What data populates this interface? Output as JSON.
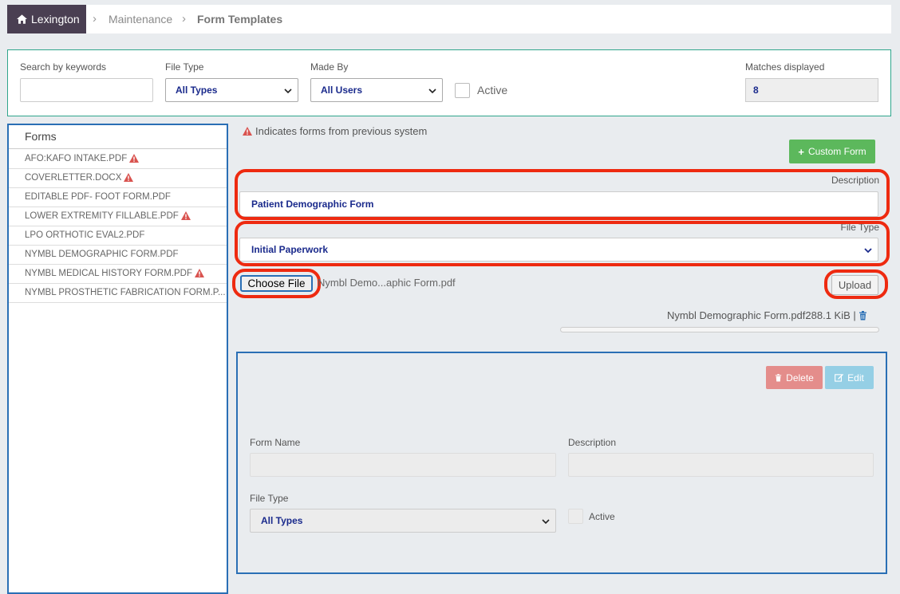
{
  "breadcrumb": {
    "home": "Lexington",
    "items": [
      "Maintenance",
      "Form Templates"
    ]
  },
  "filters": {
    "search_label": "Search by keywords",
    "search_value": "",
    "file_type_label": "File Type",
    "file_type_value": "All Types",
    "made_by_label": "Made By",
    "made_by_value": "All Users",
    "active_label": "Active",
    "matches_label": "Matches displayed",
    "matches_value": "8"
  },
  "forms": {
    "header": "Forms",
    "items": [
      {
        "name": "AFO:KAFO INTAKE.PDF",
        "warning": true
      },
      {
        "name": "COVERLETTER.DOCX",
        "warning": true
      },
      {
        "name": "EDITABLE PDF- FOOT FORM.PDF",
        "warning": false
      },
      {
        "name": "LOWER EXTREMITY FILLABLE.PDF",
        "warning": true
      },
      {
        "name": "LPO ORTHOTIC EVAL2.PDF",
        "warning": false
      },
      {
        "name": "NYMBL DEMOGRAPHIC FORM.PDF",
        "warning": false
      },
      {
        "name": "NYMBL MEDICAL HISTORY FORM.PDF",
        "warning": true
      },
      {
        "name": "NYMBL PROSTHETIC FABRICATION FORM.P...",
        "warning": false
      }
    ]
  },
  "legend": "Indicates forms from previous system",
  "custom_form_label": "Custom Form",
  "new_form": {
    "description_label": "Description",
    "description_value": "Patient Demographic Form",
    "file_type_label": "File Type",
    "file_type_value": "Initial Paperwork",
    "choose_file_label": "Choose File",
    "file_chosen": "Nymbl Demo...aphic Form.pdf",
    "upload_label": "Upload",
    "upload_info": "Nymbl Demographic Form.pdf288.1 KiB |",
    "upload_progress": 0
  },
  "detail": {
    "delete_label": "Delete",
    "edit_label": "Edit",
    "form_name_label": "Form Name",
    "description_label": "Description",
    "file_type_label": "File Type",
    "file_type_value": "All Types",
    "active_label": "Active"
  },
  "colors": {
    "annotation": "#ee2a10",
    "warning": "#d9534f",
    "primary_border": "#2a6fb5",
    "success": "#5cb85c"
  }
}
